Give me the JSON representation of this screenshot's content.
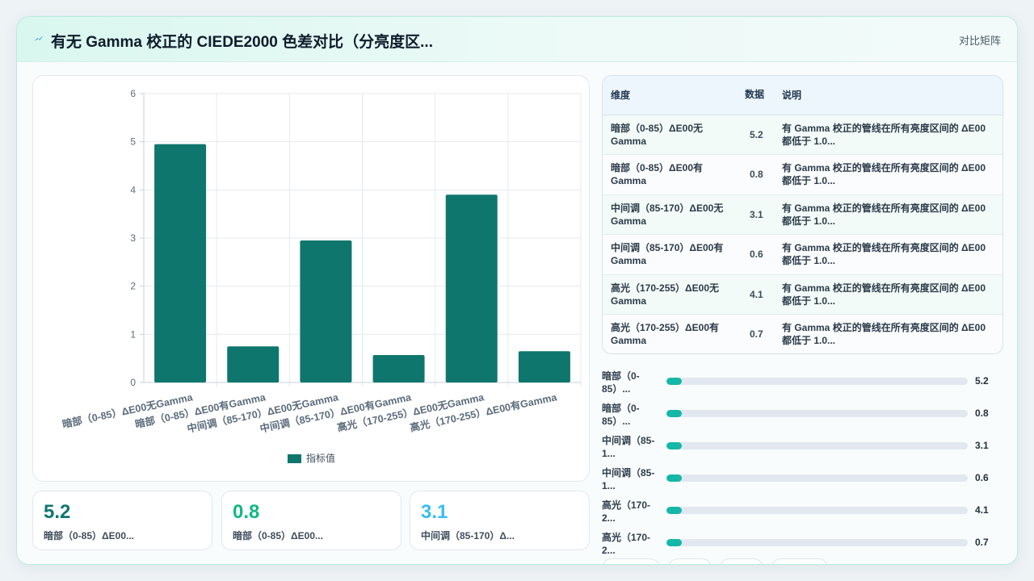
{
  "header": {
    "title": "有无 Gamma 校正的 CIEDE2000 色差对比（分亮度区...",
    "right_label": "对比矩阵"
  },
  "chart_data": {
    "type": "bar",
    "categories": [
      "暗部（0-85）ΔE00无Gamma",
      "暗部（0-85）ΔE00有Gamma",
      "中间调（85-170）ΔE00无Gamma",
      "中间调（85-170）ΔE00有Gamma",
      "高光（170-255）ΔE00无Gamma",
      "高光（170-255）ΔE00有Gamma"
    ],
    "series": [
      {
        "name": "指标值",
        "values": [
          4.95,
          0.75,
          2.95,
          0.57,
          3.9,
          0.65
        ]
      }
    ],
    "ylim": [
      0,
      6
    ],
    "yticks": [
      0,
      1,
      2,
      3,
      4,
      5,
      6
    ],
    "grid": true,
    "legend_position": "bottom",
    "color": "#0f766e"
  },
  "stats": [
    {
      "value": "5.2",
      "label": "暗部（0-85）ΔE00...",
      "color": "#0f766e"
    },
    {
      "value": "0.8",
      "label": "暗部（0-85）ΔE00...",
      "color": "#10b981"
    },
    {
      "value": "3.1",
      "label": "中间调（85-170）Δ...",
      "color": "#38bdf8"
    }
  ],
  "table": {
    "headers": [
      "维度",
      "数据",
      "说明"
    ],
    "rows": [
      {
        "dim": "暗部（0-85）ΔE00无Gamma",
        "num": "5.2",
        "desc": "有 Gamma 校正的管线在所有亮度区间的 ΔE00 都低于 1.0..."
      },
      {
        "dim": "暗部（0-85）ΔE00有Gamma",
        "num": "0.8",
        "desc": "有 Gamma 校正的管线在所有亮度区间的 ΔE00 都低于 1.0..."
      },
      {
        "dim": "中间调（85-170）ΔE00无Gamma",
        "num": "3.1",
        "desc": "有 Gamma 校正的管线在所有亮度区间的 ΔE00 都低于 1.0..."
      },
      {
        "dim": "中间调（85-170）ΔE00有Gamma",
        "num": "0.6",
        "desc": "有 Gamma 校正的管线在所有亮度区间的 ΔE00 都低于 1.0..."
      },
      {
        "dim": "高光（170-255）ΔE00无Gamma",
        "num": "4.1",
        "desc": "有 Gamma 校正的管线在所有亮度区间的 ΔE00 都低于 1.0..."
      },
      {
        "dim": "高光（170-255）ΔE00有Gamma",
        "num": "0.7",
        "desc": "有 Gamma 校正的管线在所有亮度区间的 ΔE00 都低于 1.0..."
      }
    ]
  },
  "progress": [
    {
      "label": "暗部（0-85）...",
      "value": "5.2",
      "fill_fraction": 0.05
    },
    {
      "label": "暗部（0-85）...",
      "value": "0.8",
      "fill_fraction": 0.05
    },
    {
      "label": "中间调（85-1...",
      "value": "3.1",
      "fill_fraction": 0.05
    },
    {
      "label": "中间调（85-1...",
      "value": "0.6",
      "fill_fraction": 0.05
    },
    {
      "label": "高光（170-2...",
      "value": "4.1",
      "fill_fraction": 0.05
    },
    {
      "label": "高光（170-2...",
      "value": "0.7",
      "fill_fraction": 0.05
    }
  ],
  "colors": {
    "accent": "#14b8a6",
    "brand": "#0f766e"
  }
}
